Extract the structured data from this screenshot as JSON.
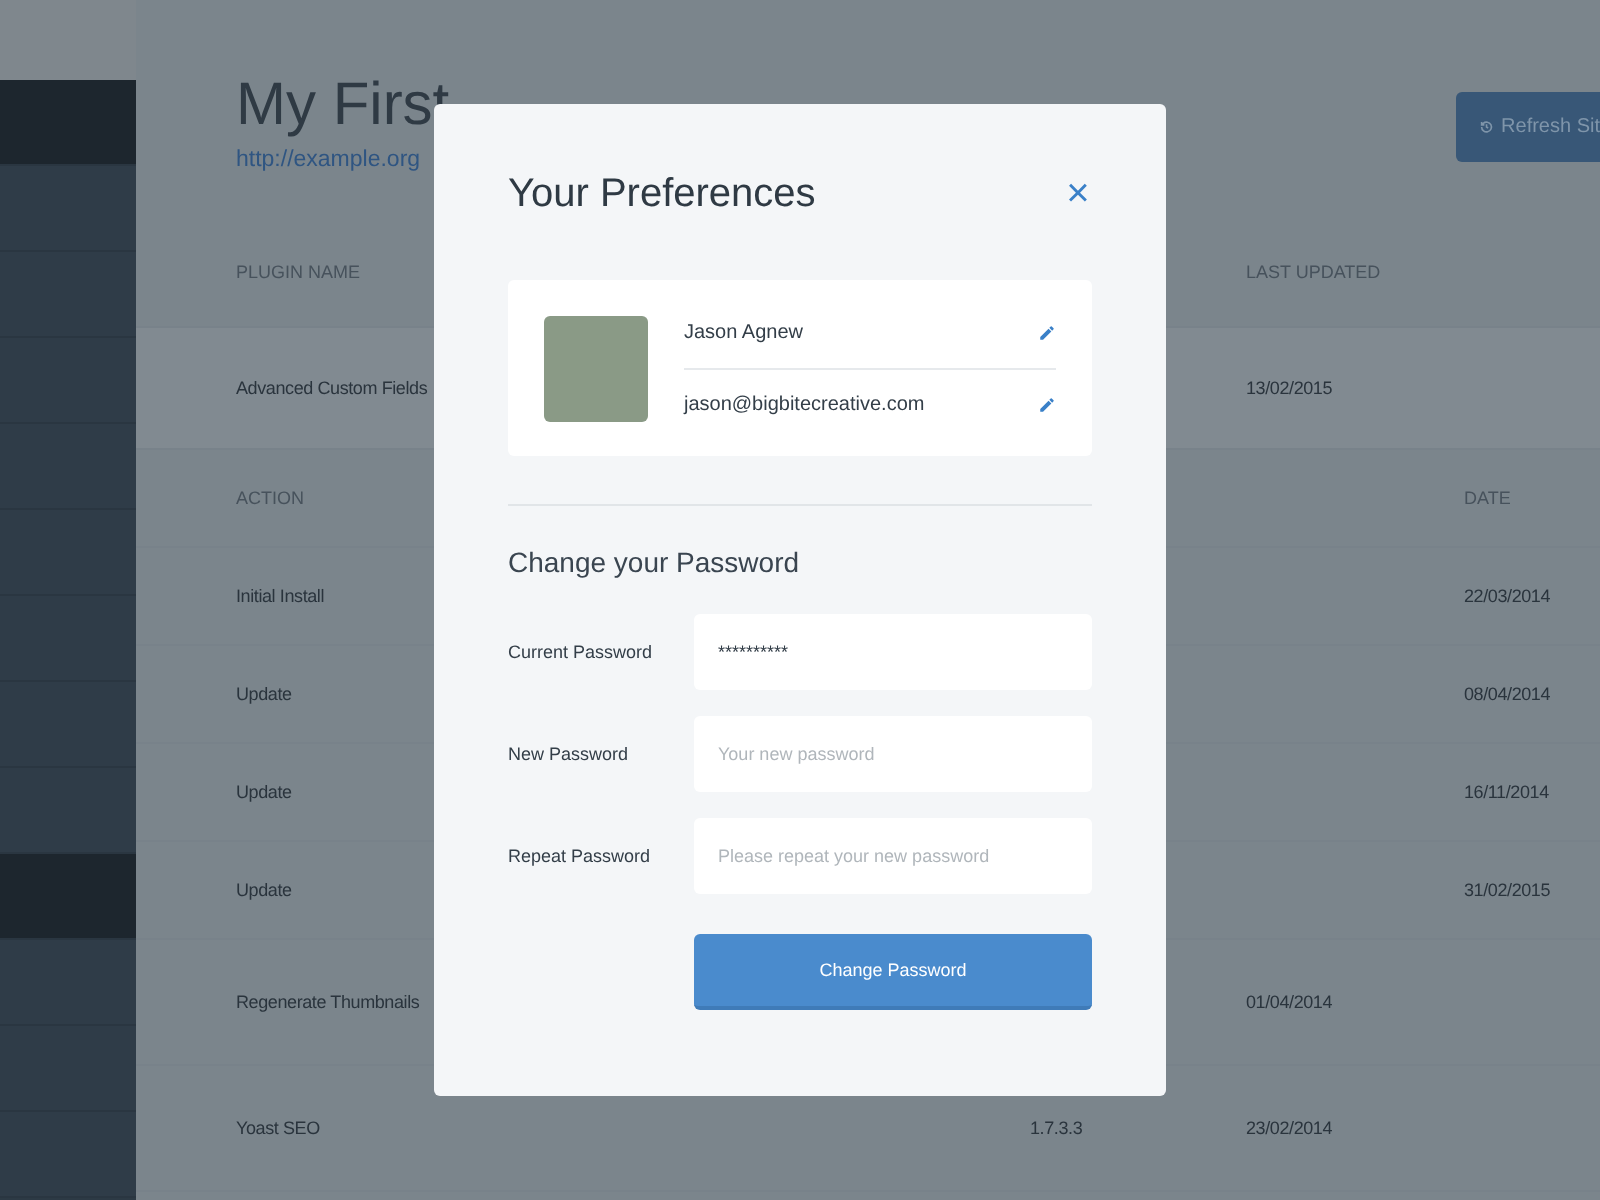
{
  "sidebar": {
    "items": [
      {
        "selected": true
      },
      {
        "selected": false
      },
      {
        "selected": false
      },
      {
        "selected": false
      },
      {
        "selected": false
      },
      {
        "selected": false
      },
      {
        "selected": false
      },
      {
        "selected": false
      },
      {
        "selected": false
      },
      {
        "selected": true
      },
      {
        "selected": false
      },
      {
        "selected": false
      },
      {
        "selected": false
      }
    ]
  },
  "site": {
    "title": "My First",
    "url": "http://example.org",
    "refresh_button": "Refresh Sit"
  },
  "plugins": {
    "columns": [
      "PLUGIN NAME",
      "LAST UPDATED"
    ],
    "rows": [
      {
        "name": "Advanced Custom Fields",
        "updated": "13/02/2015",
        "history": {
          "columns": [
            "ACTION",
            "DATE"
          ],
          "rows": [
            {
              "action": "Initial Install",
              "date": "22/03/2014"
            },
            {
              "action": "Update",
              "date": "08/04/2014"
            },
            {
              "action": "Update",
              "date": "16/11/2014"
            },
            {
              "action": "Update",
              "date": "31/02/2015"
            }
          ]
        }
      },
      {
        "name": "Regenerate Thumbnails",
        "updated": "01/04/2014"
      },
      {
        "name": "Yoast SEO",
        "version": "1.7.3.3",
        "updated": "23/02/2014"
      }
    ]
  },
  "modal": {
    "title": "Your Preferences",
    "close": "×",
    "profile": {
      "name": "Jason Agnew",
      "email": "jason@bigbitecreative.com"
    },
    "section_title": "Change your Password",
    "fields": [
      {
        "label": "Current Password",
        "value": "**********"
      },
      {
        "label": "New Password",
        "placeholder": "Your new password"
      },
      {
        "label": "Repeat Password",
        "placeholder": "Please repeat your new password"
      }
    ],
    "submit": "Change Password"
  }
}
